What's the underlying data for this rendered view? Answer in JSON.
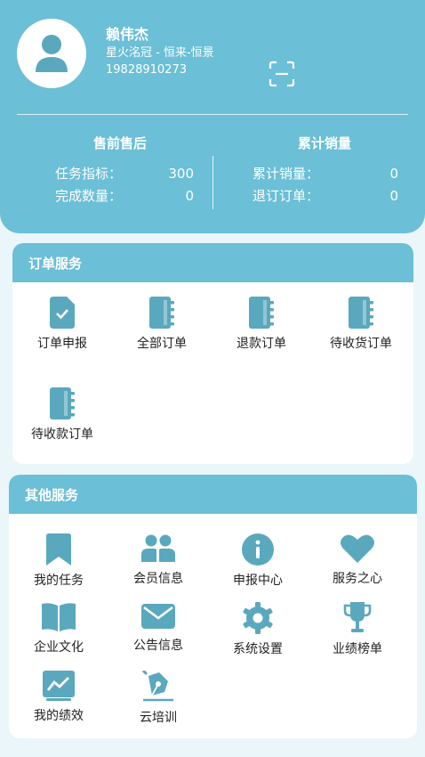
{
  "colors": {
    "primary": "#6bbfd6",
    "icon": "#5aa8bd",
    "background": "#eaf6fa"
  },
  "profile": {
    "name": "赖伟杰",
    "company": "星火洺冠 - 恒来-恒景",
    "phone": "19828910273",
    "avatar_icon": "user-icon",
    "scan_icon": "scan-icon"
  },
  "stats": {
    "presale": {
      "title": "售前售后",
      "rows": [
        {
          "label": "任务指标：",
          "value": "300"
        },
        {
          "label": "完成数量：",
          "value": "0"
        }
      ]
    },
    "sales": {
      "title": "累计销量",
      "rows": [
        {
          "label": "累计销量：",
          "value": "0"
        },
        {
          "label": "退订订单：",
          "value": "0"
        }
      ]
    }
  },
  "order_services": {
    "title": "订单服务",
    "items": [
      {
        "label": "订单申报",
        "icon": "file-check-icon"
      },
      {
        "label": "全部订单",
        "icon": "notebook-icon"
      },
      {
        "label": "退款订单",
        "icon": "notebook-icon"
      },
      {
        "label": "待收货订单",
        "icon": "notebook-icon"
      },
      {
        "label": "待收款订单",
        "icon": "notebook-icon"
      }
    ]
  },
  "other_services": {
    "title": "其他服务",
    "items": [
      {
        "label": "我的任务",
        "icon": "bookmark-icon"
      },
      {
        "label": "会员信息",
        "icon": "users-icon"
      },
      {
        "label": "申报中心",
        "icon": "info-icon"
      },
      {
        "label": "服务之心",
        "icon": "heart-icon"
      },
      {
        "label": "企业文化",
        "icon": "book-icon"
      },
      {
        "label": "公告信息",
        "icon": "mail-icon"
      },
      {
        "label": "系统设置",
        "icon": "gear-icon"
      },
      {
        "label": "业绩榜单",
        "icon": "trophy-icon"
      },
      {
        "label": "我的绩效",
        "icon": "chart-icon"
      },
      {
        "label": "云培训",
        "icon": "pen-icon"
      }
    ]
  }
}
